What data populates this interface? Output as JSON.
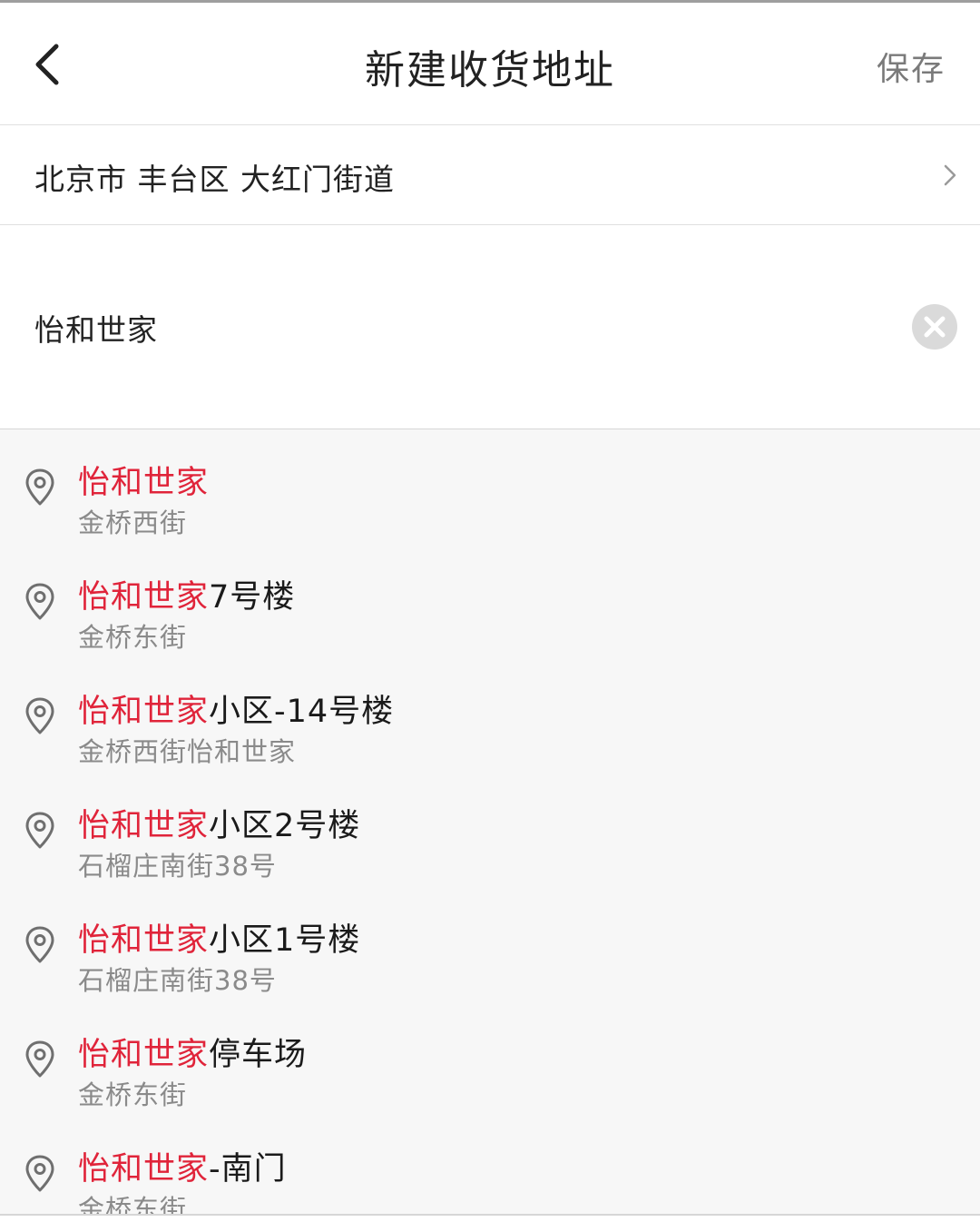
{
  "header": {
    "title": "新建收货地址",
    "save_label": "保存",
    "back_icon": "chevron-left-icon"
  },
  "region": {
    "text": "北京市 丰台区 大红门街道"
  },
  "search": {
    "value": "怡和世家"
  },
  "colors": {
    "highlight": "#e0243a",
    "subtext": "#8a8a8a",
    "list_background": "#f7f7f7"
  },
  "suggestions": [
    {
      "highlight": "怡和世家",
      "rest": "",
      "address": "金桥西街"
    },
    {
      "highlight": "怡和世家",
      "rest": "7号楼",
      "address": "金桥东街"
    },
    {
      "highlight": "怡和世家",
      "rest": "小区-14号楼",
      "address": "金桥西街怡和世家"
    },
    {
      "highlight": "怡和世家",
      "rest": "小区2号楼",
      "address": "石榴庄南街38号"
    },
    {
      "highlight": "怡和世家",
      "rest": "小区1号楼",
      "address": "石榴庄南街38号"
    },
    {
      "highlight": "怡和世家",
      "rest": "停车场",
      "address": "金桥东街"
    },
    {
      "highlight": "怡和世家",
      "rest": "-南门",
      "address": "金桥东街"
    }
  ]
}
